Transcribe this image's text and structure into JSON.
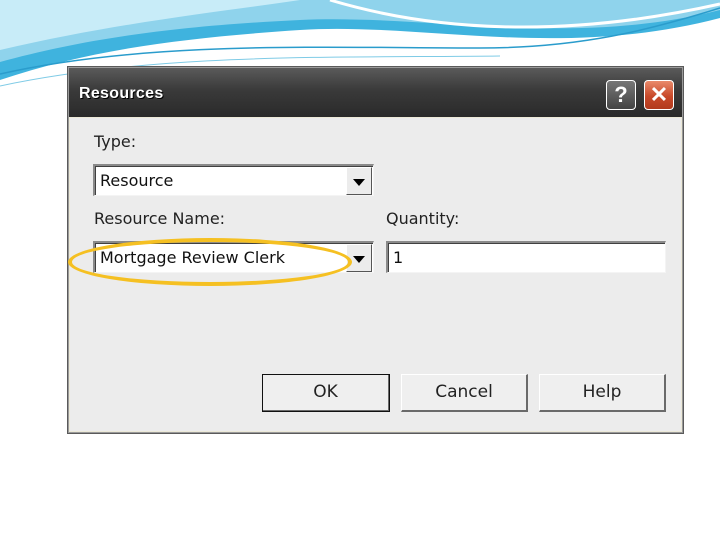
{
  "dialog": {
    "title": "Resources",
    "help_glyph": "?",
    "close_glyph": "✕"
  },
  "type_field": {
    "label": "Type:",
    "value": "Resource"
  },
  "resource_name_field": {
    "label": "Resource Name:",
    "value": "Mortgage Review Clerk"
  },
  "quantity_field": {
    "label": "Quantity:",
    "value": "1"
  },
  "buttons": {
    "ok": "OK",
    "cancel": "Cancel",
    "help": "Help"
  },
  "colors": {
    "highlight": "#f5c022",
    "close_button": "#c8492a",
    "titlebar": "#3a3a3a"
  },
  "icons": [
    "help-icon",
    "close-icon",
    "dropdown-arrow-icon"
  ]
}
